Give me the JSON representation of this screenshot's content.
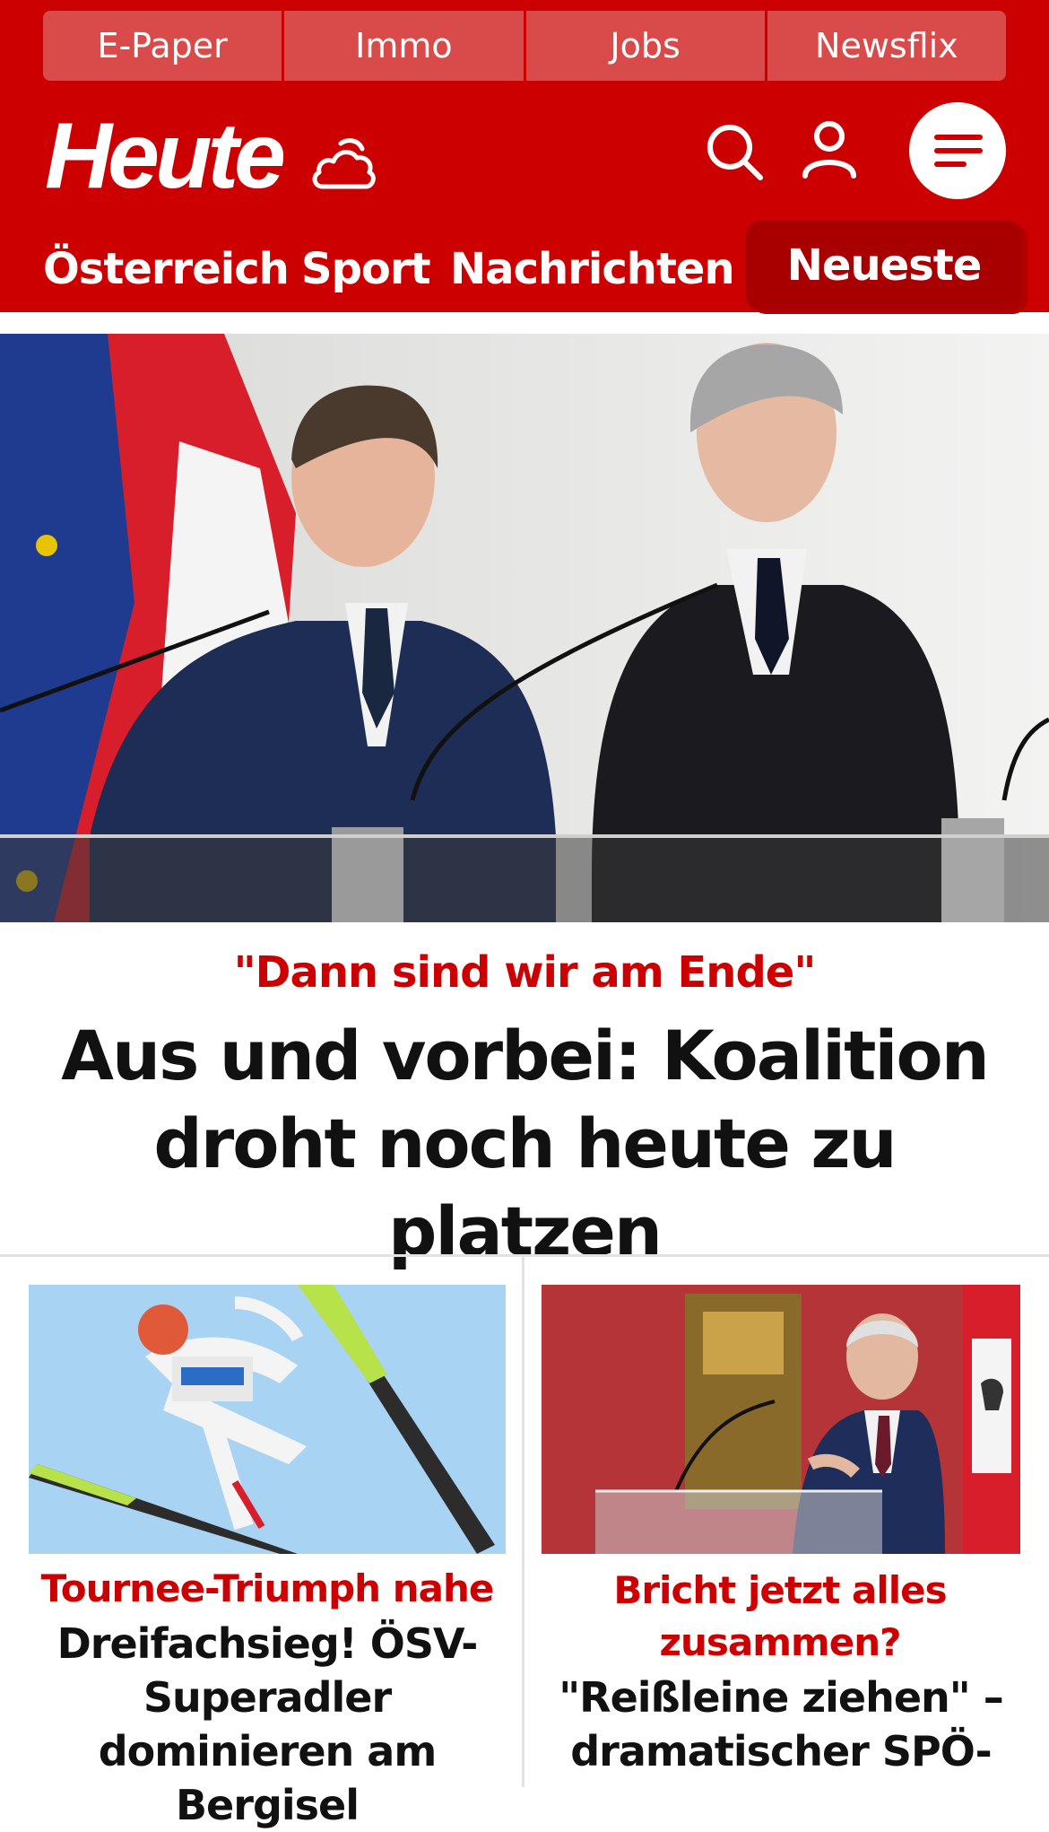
{
  "top_links": [
    "E-Paper",
    "Immo",
    "Jobs",
    "Newsflix"
  ],
  "header": {
    "logo_text": "Heute",
    "weather_icon": "cloud-icon",
    "search_icon": "search-icon",
    "account_icon": "user-icon",
    "menu_icon": "hamburger-menu-icon"
  },
  "nav": {
    "items": [
      "Österreich",
      "Sport",
      "Nachrichten"
    ],
    "active": "Neueste"
  },
  "hero": {
    "kicker": "\"Dann sind wir am Ende\"",
    "title": "Aus und vorbei: Koalition droht noch heute zu platzen"
  },
  "cards": [
    {
      "kicker": "Tournee-Triumph nahe",
      "title": "Dreifachsieg! ÖSV-Superadler dominieren am Bergisel"
    },
    {
      "kicker": "Bricht jetzt alles zusammen?",
      "title": "\"Reißleine ziehen\" – dramatischer SPÖ-"
    }
  ],
  "colors": {
    "brand_red": "#cc0000",
    "active_tab": "#a80000",
    "text": "#111111"
  }
}
